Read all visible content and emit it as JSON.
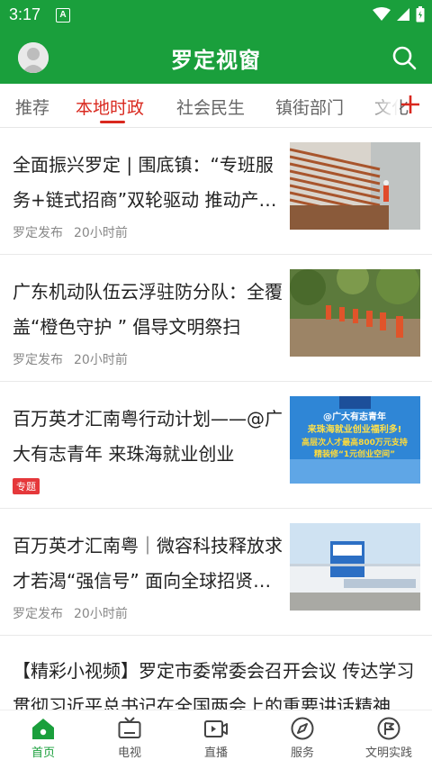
{
  "status_bar": {
    "time": "3:17",
    "notification_icon": "A"
  },
  "app_bar": {
    "title": "罗定视窗"
  },
  "tabs": [
    {
      "label": "推荐"
    },
    {
      "label": "本地时政"
    },
    {
      "label": "社会民生"
    },
    {
      "label": "镇街部门"
    },
    {
      "label": "文化"
    }
  ],
  "news": [
    {
      "title": "全面振兴罗定 | 围底镇：“专班服务+链式招商”双轮驱动 推动产业高质量发展",
      "source": "罗定发布",
      "time": "20小时前"
    },
    {
      "title": "广东机动队伍云浮驻防分队：全覆盖“橙色守护 ” 倡导文明祭扫",
      "source": "罗定发布",
      "time": "20小时前"
    },
    {
      "title": "百万英才汇南粤行动计划——@广大有志青年  来珠海就业创业",
      "badge": "专题",
      "thumb_text": [
        "@广大有志青年",
        "来珠海就业创业福利多!",
        "高层次人才最高800万元支持",
        "精装修“1元创业空间”"
      ]
    },
    {
      "title": "百万英才汇南粤｜微容科技释放求才若渴“强信号” 面向全球招贤纳士",
      "source": "罗定发布",
      "time": "20小时前"
    },
    {
      "title": "【精彩小视频】罗定市委常委会召开会议 传达学习贯彻习近平总书记在全国两会上的重要讲话精神"
    }
  ],
  "bottom_nav": [
    {
      "label": "首页",
      "icon": "home-icon",
      "active": true
    },
    {
      "label": "电视",
      "icon": "tv-icon"
    },
    {
      "label": "直播",
      "icon": "live-icon"
    },
    {
      "label": "服务",
      "icon": "compass-icon"
    },
    {
      "label": "文明实践",
      "icon": "flag-icon"
    }
  ],
  "colors": {
    "brand": "#1a9f3c",
    "accent": "#d9281e",
    "badge": "#e5383b"
  }
}
